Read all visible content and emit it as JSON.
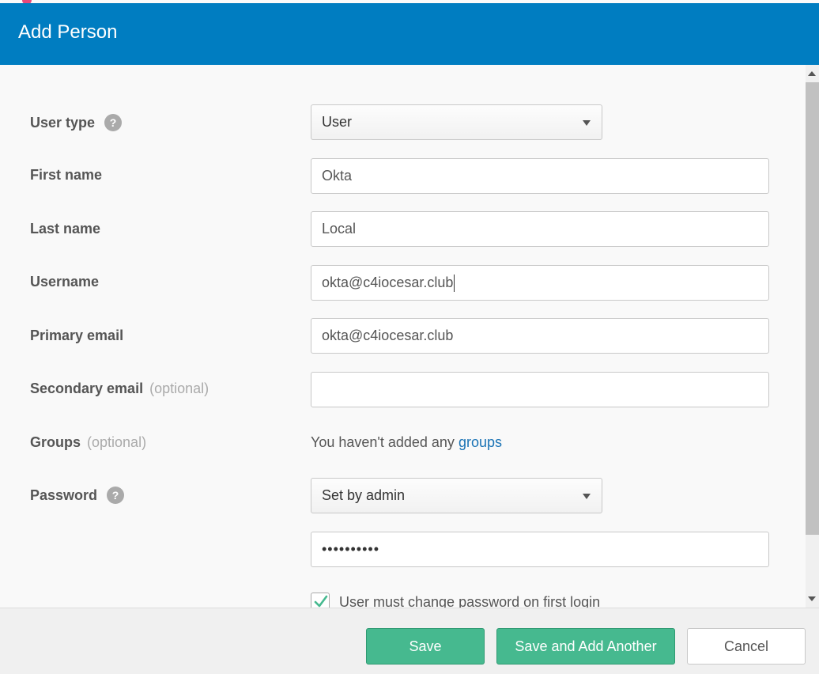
{
  "modal": {
    "title": "Add Person"
  },
  "form": {
    "user_type": {
      "label": "User type",
      "help": "?",
      "value": "User"
    },
    "first_name": {
      "label": "First name",
      "value": "Okta"
    },
    "last_name": {
      "label": "Last name",
      "value": "Local"
    },
    "username": {
      "label": "Username",
      "value": "okta@c4iocesar.club"
    },
    "primary_email": {
      "label": "Primary email",
      "value": "okta@c4iocesar.club"
    },
    "secondary_email": {
      "label": "Secondary email",
      "optional": "(optional)",
      "value": ""
    },
    "groups": {
      "label": "Groups",
      "optional": "(optional)",
      "text": "You haven't added any",
      "link": "groups"
    },
    "password": {
      "label": "Password",
      "help": "?",
      "mode": "Set by admin",
      "masked_value": "••••••••••"
    },
    "change_password": {
      "label": "User must change password on first login",
      "checked": true
    }
  },
  "footer": {
    "save": "Save",
    "save_add_another": "Save and Add Another",
    "cancel": "Cancel"
  },
  "colors": {
    "header": "#007dc1",
    "primary_button": "#46b98f",
    "link": "#1a73b5",
    "checkmark": "#46b98f"
  },
  "icons": {
    "help": "question-circle-icon",
    "dropdown": "chevron-down-icon",
    "check": "checkmark-icon"
  }
}
